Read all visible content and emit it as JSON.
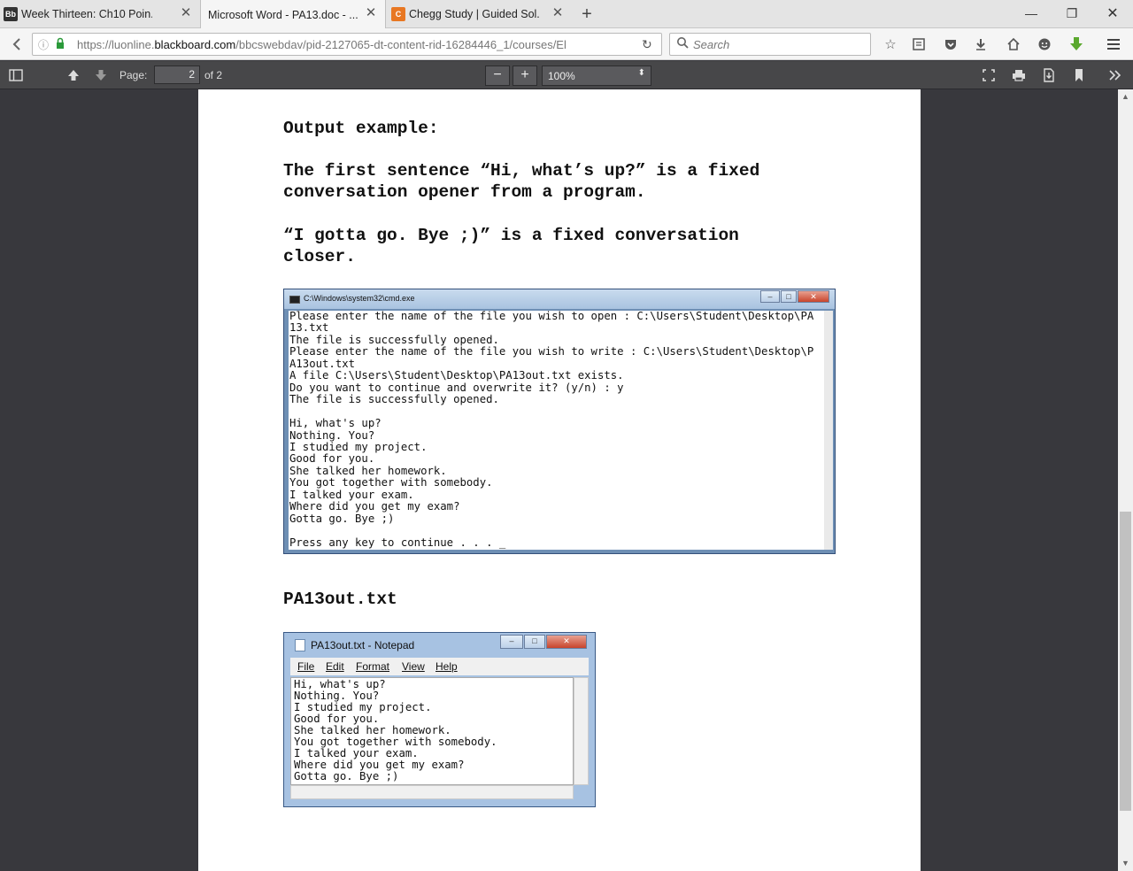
{
  "browser": {
    "tabs": [
      {
        "favicon": "Bb",
        "label": "Week Thirteen: Ch10 Poin..."
      },
      {
        "favicon": "",
        "label": "Microsoft Word - PA13.doc - ..."
      },
      {
        "favicon": "C",
        "label": "Chegg Study | Guided Sol..."
      }
    ],
    "url_prefix": "https://luonline.",
    "url_domain": "blackboard.com",
    "url_rest": "/bbcswebdav/pid-2127065-dt-content-rid-16284446_1/courses/El",
    "search_placeholder": "Search"
  },
  "pdf_toolbar": {
    "page_label": "Page:",
    "page_current": "2",
    "page_total": "of 2",
    "zoom": "100%"
  },
  "document": {
    "output_heading": "Output example:",
    "paragraph1_line1": "The first sentence “Hi, what’s up?” is a fixed",
    "paragraph1_line2": "conversation opener from a program.",
    "paragraph2_line1": "“I gotta go. Bye ;)” is a fixed conversation",
    "paragraph2_line2": "closer.",
    "file_heading": "PA13out.txt"
  },
  "cmd_window": {
    "title": "C:\\Windows\\system32\\cmd.exe",
    "text": "Please enter the name of the file you wish to open : C:\\Users\\Student\\Desktop\\PA\n13.txt\nThe file is successfully opened.\nPlease enter the name of the file you wish to write : C:\\Users\\Student\\Desktop\\P\nA13out.txt\nA file C:\\Users\\Student\\Desktop\\PA13out.txt exists.\nDo you want to continue and overwrite it? (y/n) : y\nThe file is successfully opened.\n\nHi, what's up?\nNothing. You?\nI studied my project.\nGood for you.\nShe talked her homework.\nYou got together with somebody.\nI talked your exam.\nWhere did you get my exam?\nGotta go. Bye ;)\n\nPress any key to continue . . . _"
  },
  "notepad_window": {
    "title": "PA13out.txt - Notepad",
    "menu": [
      "File",
      "Edit",
      "Format",
      "View",
      "Help"
    ],
    "text": "Hi, what's up?\nNothing. You?\nI studied my project.\nGood for you.\nShe talked her homework.\nYou got together with somebody.\nI talked your exam.\nWhere did you get my exam?\nGotta go. Bye ;)"
  }
}
